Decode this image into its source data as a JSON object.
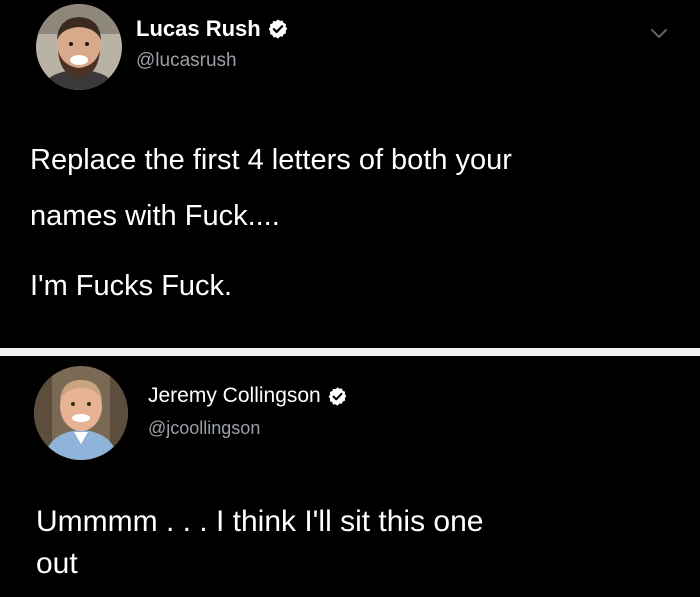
{
  "colors": {
    "background": "#000000",
    "divider": "#f2f2f2",
    "text": "#ffffff",
    "handle": "#9aa0a6",
    "verified_badge": "#ffffff"
  },
  "tweets": [
    {
      "author_name": "Lucas Rush",
      "handle": "@lucasrush",
      "verified": true,
      "menu_icon": "chevron-down-icon",
      "text_lines": [
        "Replace the first 4 letters of both your",
        "names with Fuck....",
        "I'm Fucks Fuck."
      ]
    },
    {
      "author_name": "Jeremy Collingson",
      "handle": "@jcoollingson",
      "verified": true,
      "text_lines": [
        "Ummmm . . . I think I'll sit this one",
        "out"
      ]
    }
  ]
}
